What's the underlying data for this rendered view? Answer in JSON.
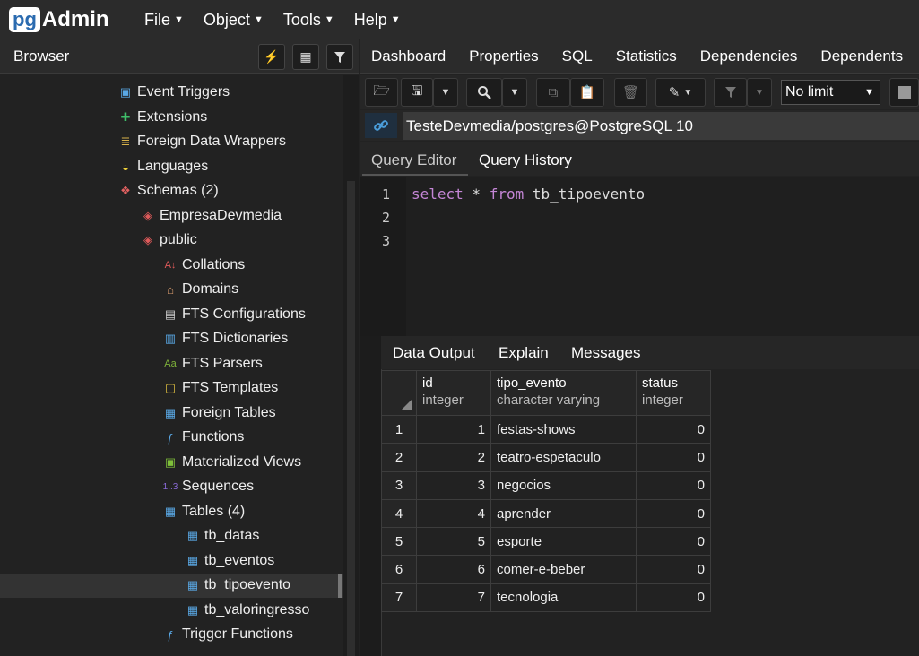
{
  "app": {
    "logo_pg": "pg",
    "logo_admin": "Admin"
  },
  "menu": [
    {
      "label": "File"
    },
    {
      "label": "Object"
    },
    {
      "label": "Tools"
    },
    {
      "label": "Help"
    }
  ],
  "browser": {
    "title": "Browser",
    "tree": [
      {
        "label": "Event Triggers",
        "icon": "event-trigger-icon"
      },
      {
        "label": "Extensions",
        "icon": "extension-icon"
      },
      {
        "label": "Foreign Data Wrappers",
        "icon": "fdw-icon"
      },
      {
        "label": "Languages",
        "icon": "language-icon"
      },
      {
        "label": "Schemas (2)",
        "icon": "schemas-icon"
      },
      {
        "label": "EmpresaDevmedia",
        "icon": "schema-icon"
      },
      {
        "label": "public",
        "icon": "schema-icon"
      },
      {
        "label": "Collations",
        "icon": "collation-icon"
      },
      {
        "label": "Domains",
        "icon": "domain-icon"
      },
      {
        "label": "FTS Configurations",
        "icon": "fts-config-icon"
      },
      {
        "label": "FTS Dictionaries",
        "icon": "fts-dictionary-icon"
      },
      {
        "label": "FTS Parsers",
        "icon": "fts-parser-icon"
      },
      {
        "label": "FTS Templates",
        "icon": "fts-template-icon"
      },
      {
        "label": "Foreign Tables",
        "icon": "foreign-table-icon"
      },
      {
        "label": "Functions",
        "icon": "function-icon"
      },
      {
        "label": "Materialized Views",
        "icon": "materialized-view-icon"
      },
      {
        "label": "Sequences",
        "icon": "sequence-icon"
      },
      {
        "label": "Tables (4)",
        "icon": "tables-icon"
      },
      {
        "label": "tb_datas",
        "icon": "table-icon"
      },
      {
        "label": "tb_eventos",
        "icon": "table-icon"
      },
      {
        "label": "tb_tipoevento",
        "icon": "table-icon"
      },
      {
        "label": "tb_valoringresso",
        "icon": "table-icon"
      },
      {
        "label": "Trigger Functions",
        "icon": "trigger-function-icon"
      }
    ]
  },
  "tabs": [
    {
      "label": "Dashboard"
    },
    {
      "label": "Properties"
    },
    {
      "label": "SQL"
    },
    {
      "label": "Statistics"
    },
    {
      "label": "Dependencies"
    },
    {
      "label": "Dependents"
    }
  ],
  "toolbar": {
    "limit_value": "No limit"
  },
  "connection": {
    "label": "TesteDevmedia/postgres@PostgreSQL 10"
  },
  "query_tabs": {
    "editor": "Query Editor",
    "history": "Query History"
  },
  "editor": {
    "line_numbers": [
      "1",
      "2",
      "3"
    ],
    "kw_select": "select",
    "star": " * ",
    "kw_from": "from",
    "table": " tb_tipoevento"
  },
  "output_tabs": {
    "data_output": "Data Output",
    "explain": "Explain",
    "messages": "Messages"
  },
  "grid": {
    "columns": [
      {
        "name": "id",
        "type": "integer"
      },
      {
        "name": "tipo_evento",
        "type": "character varying"
      },
      {
        "name": "status",
        "type": "integer"
      }
    ],
    "rows": [
      {
        "rn": "1",
        "id": "1",
        "tipo_evento": "festas-shows",
        "status": "0"
      },
      {
        "rn": "2",
        "id": "2",
        "tipo_evento": "teatro-espetaculo",
        "status": "0"
      },
      {
        "rn": "3",
        "id": "3",
        "tipo_evento": "negocios",
        "status": "0"
      },
      {
        "rn": "4",
        "id": "4",
        "tipo_evento": "aprender",
        "status": "0"
      },
      {
        "rn": "5",
        "id": "5",
        "tipo_evento": "esporte",
        "status": "0"
      },
      {
        "rn": "6",
        "id": "6",
        "tipo_evento": "comer-e-beber",
        "status": "0"
      },
      {
        "rn": "7",
        "id": "7",
        "tipo_evento": "tecnologia",
        "status": "0"
      }
    ]
  },
  "colors": {
    "accent": "#2b6bb0",
    "keyword": "#c486d6",
    "background": "#222222"
  }
}
